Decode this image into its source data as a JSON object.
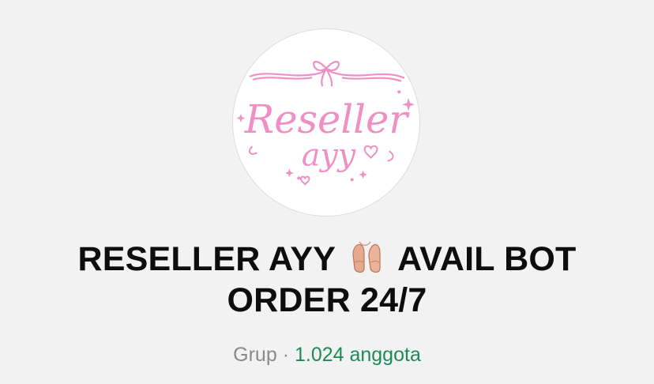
{
  "group": {
    "name_line1_before": "RESELLER AYY",
    "name_line1_after": "AVAIL BOT",
    "name_line2": "ORDER 24/7",
    "emoji": "ballet-shoes-icon",
    "avatar": {
      "logo_word1": "Reseller",
      "logo_word2": "ayy",
      "accent": "#f08fc4"
    },
    "type": "Grup",
    "separator": "·",
    "members": "1.024 anggota"
  },
  "colors": {
    "title": "#0d0d0d",
    "muted": "#8a8a8a",
    "members": "#1f8a55"
  }
}
